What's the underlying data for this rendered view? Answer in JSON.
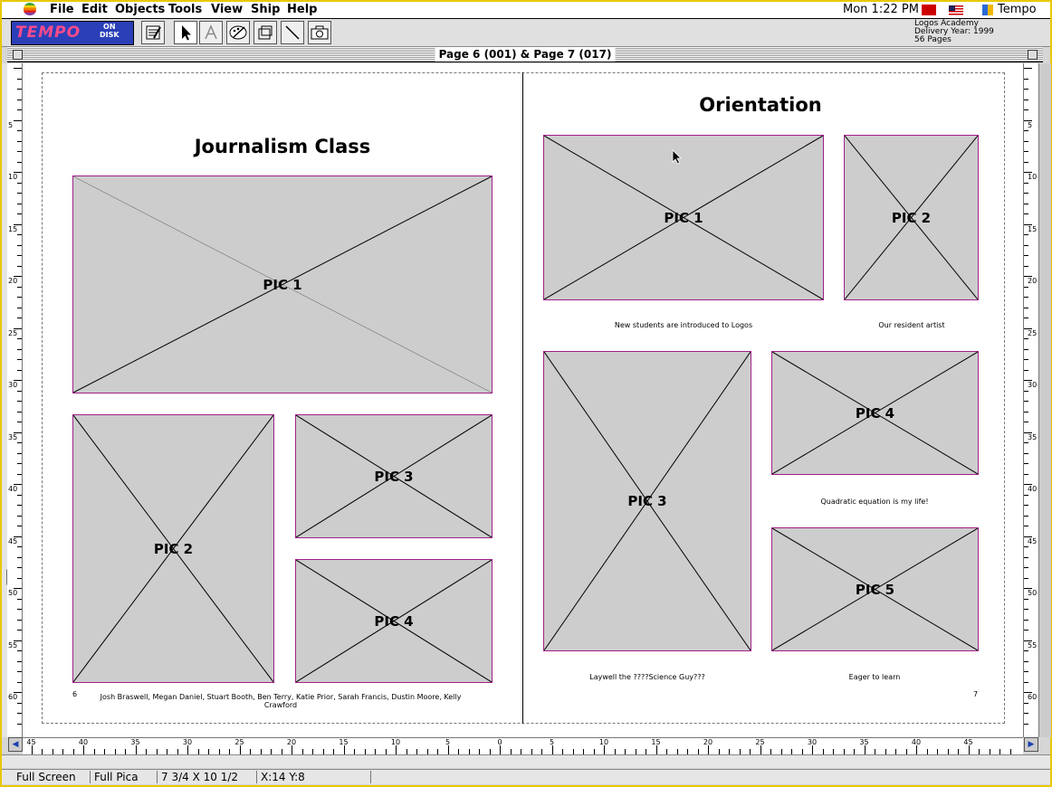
{
  "menubar": {
    "items": [
      "File",
      "Edit",
      "Objects",
      "Tools",
      "View",
      "Ship",
      "Help"
    ],
    "clock": "Mon 1:22 PM",
    "app_name": "Tempo"
  },
  "toolbar": {
    "logo_main": "TEMPO",
    "logo_sub1": "ON",
    "logo_sub2": "DISK",
    "doc_school": "Logos Academy",
    "doc_year": "Delivery Year: 1999",
    "doc_pages": "56 Pages"
  },
  "window": {
    "title": "Page 6 (001) & Page 7 (017)"
  },
  "left_page": {
    "title": "Journalism Class",
    "page_number": "6",
    "caption": "Josh Braswell, Megan Daniel, Stuart Booth, Ben Terry, Katie Prior, Sarah Francis, Dustin Moore, Kelly",
    "caption_line2": "Crawford",
    "pics": [
      "PIC 1",
      "PIC 2",
      "PIC 3",
      "PIC 4"
    ]
  },
  "right_page": {
    "title": "Orientation",
    "page_number": "7",
    "pics": [
      "PIC 1",
      "PIC 2",
      "PIC 3",
      "PIC 4",
      "PIC 5"
    ],
    "captions": [
      "New students are introduced to Logos",
      "Our resident artist",
      "Quadratic equation is my life!",
      "Laywell the ????Science Guy???",
      "Eager to learn"
    ]
  },
  "rulers": {
    "vertical": [
      "5",
      "10",
      "15",
      "20",
      "25",
      "30",
      "35",
      "40",
      "45",
      "50",
      "55",
      "60"
    ],
    "horizontal": [
      "45",
      "40",
      "35",
      "30",
      "25",
      "20",
      "15",
      "10",
      "5",
      "0",
      "5",
      "10",
      "15",
      "20",
      "25",
      "30",
      "35",
      "40",
      "45"
    ]
  },
  "statusbar": {
    "view_mode": "Full Screen",
    "units": "Full Pica",
    "page_size": "7 3/4 X 10 1/2",
    "coords": "X:14  Y:8"
  }
}
